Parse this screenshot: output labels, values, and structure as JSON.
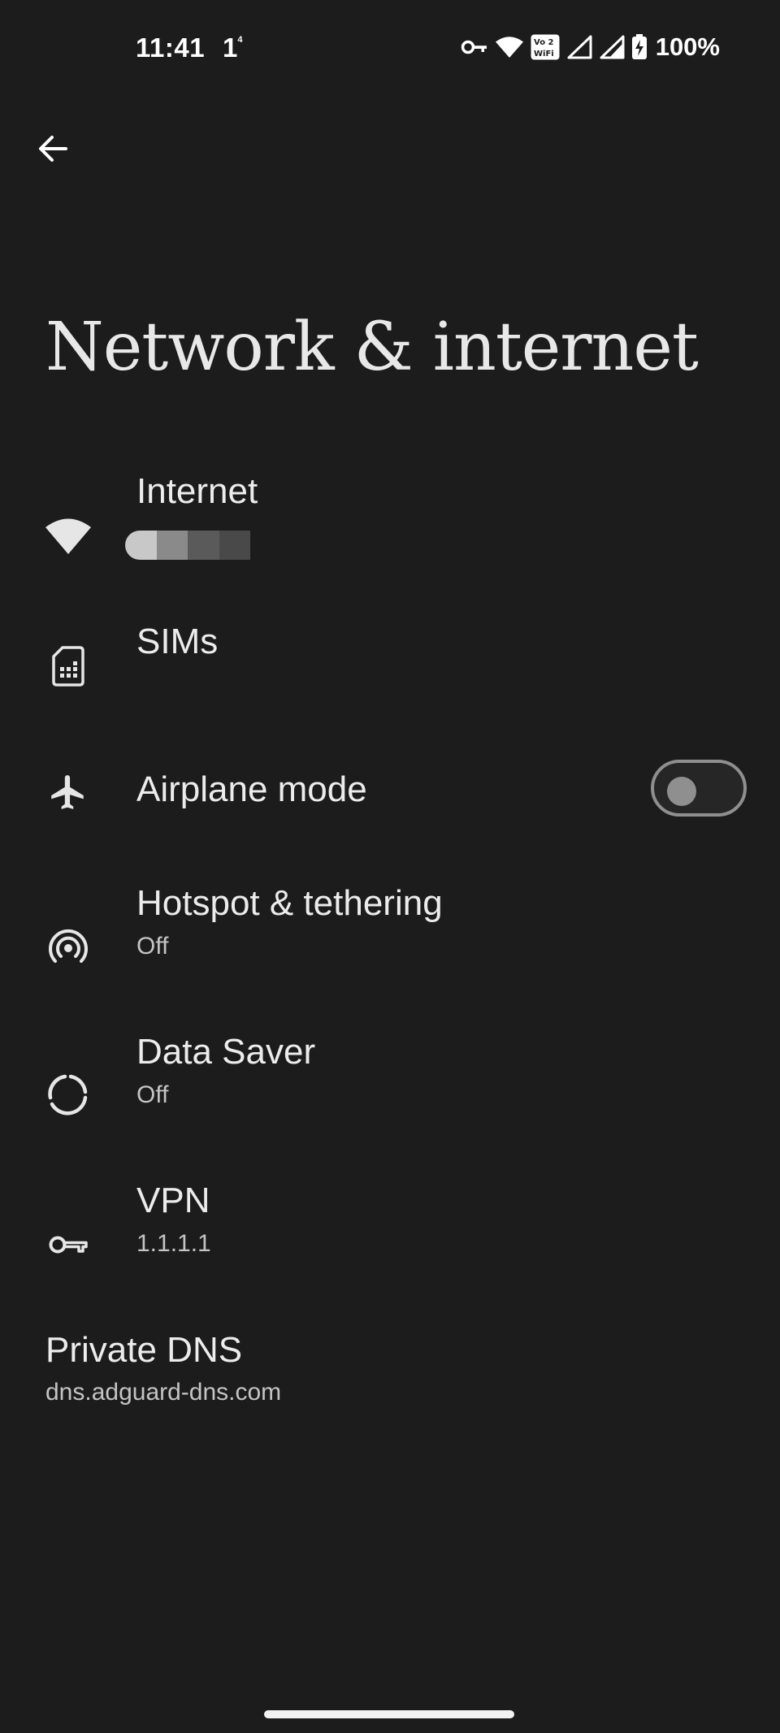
{
  "status_bar": {
    "time": "11:41",
    "notification_digit": "1",
    "notification_superscript": "4",
    "battery_percent": "100%",
    "icons": [
      "vpn-key-icon",
      "wifi-icon",
      "vowifi-icon",
      "signal-icon",
      "signal-icon",
      "battery-charging-icon"
    ],
    "vowifi_top": "Vo 2",
    "vowifi_bottom": "WiFi"
  },
  "header": {
    "back_icon": "arrow-back-icon",
    "title": "Network & internet"
  },
  "items": [
    {
      "id": "internet",
      "title": "Internet",
      "summary": "",
      "icon": "wifi-icon"
    },
    {
      "id": "sims",
      "title": "SIMs",
      "summary": "",
      "icon": "sim-card-icon"
    },
    {
      "id": "airplane",
      "title": "Airplane mode",
      "summary": "",
      "icon": "airplane-icon",
      "toggle_on": false
    },
    {
      "id": "hotspot",
      "title": "Hotspot & tethering",
      "summary": "Off",
      "icon": "hotspot-icon"
    },
    {
      "id": "data_saver",
      "title": "Data Saver",
      "summary": "Off",
      "icon": "data-saver-icon"
    },
    {
      "id": "vpn",
      "title": "VPN",
      "summary": "1.1.1.1",
      "icon": "vpn-key-icon"
    }
  ],
  "private_dns": {
    "title": "Private DNS",
    "summary": "dns.adguard-dns.com"
  },
  "colors": {
    "background": "#1c1c1c",
    "text_primary": "#ececec",
    "text_secondary": "#c4c4c4",
    "toggle_off": "#8f8f8f"
  }
}
